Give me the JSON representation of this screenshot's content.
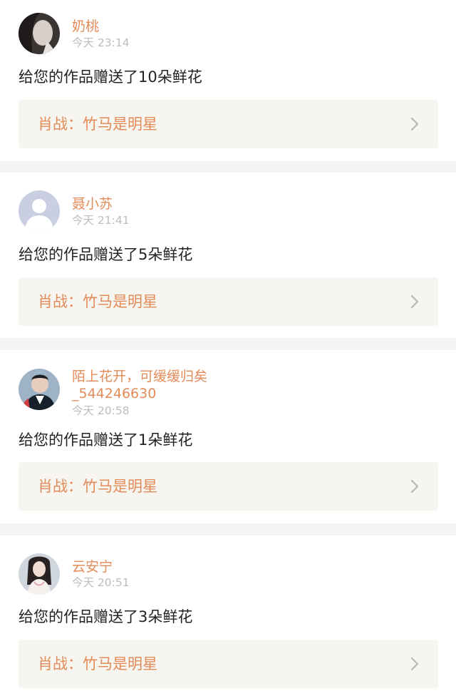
{
  "notifications": [
    {
      "user": "奶桃",
      "time": "今天 23:14",
      "message": "给您的作品赠送了10朵鲜花",
      "work": "肖战：竹马是明星",
      "avatar": "photo-avatar"
    },
    {
      "user": "聂小苏",
      "time": "今天 21:41",
      "message": "给您的作品赠送了5朵鲜花",
      "work": "肖战：竹马是明星",
      "avatar": "default-avatar"
    },
    {
      "user_line1": "陌上花开，可缓缓归矣",
      "user_line2": "_544246630",
      "time": "今天 20:58",
      "message": "给您的作品赠送了1朵鲜花",
      "work": "肖战：竹马是明星",
      "avatar": "photo-avatar"
    },
    {
      "user": "云安宁",
      "time": "今天 20:51",
      "message": "给您的作品赠送了3朵鲜花",
      "work": "肖战：竹马是明星",
      "avatar": "photo-avatar"
    }
  ],
  "colors": {
    "accent": "#e38b59",
    "timestamp": "#bdbdbd",
    "message": "#222222",
    "work_bg": "#f6f5ef",
    "page_bg": "#f4f4f4"
  },
  "icons": {
    "chevron": "chevron-right-icon"
  }
}
